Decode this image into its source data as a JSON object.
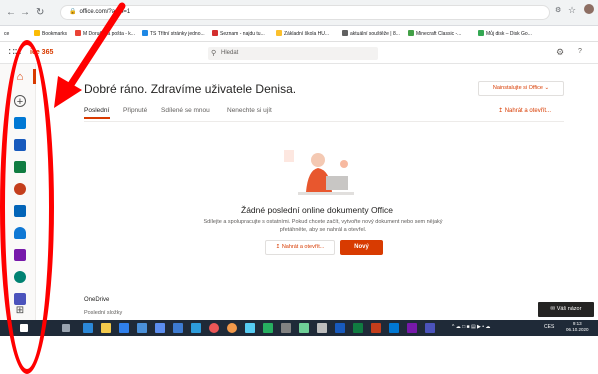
{
  "browser": {
    "url": "office.com/?auth=1",
    "bookmarks": [
      {
        "label": "ce",
        "color": "#ffffff"
      },
      {
        "label": "Bookmarks",
        "color": "#fbbc05"
      },
      {
        "label": "M Doručená pošta - k...",
        "color": "#ea4335"
      },
      {
        "label": "TS Třítní stránky jedno...",
        "color": "#1e88e5"
      },
      {
        "label": "Seznam - najdu tu...",
        "color": "#d32f2f"
      },
      {
        "label": "Základní škola HU...",
        "color": "#fbc02d"
      },
      {
        "label": "aktuální souštěže | 8...",
        "color": "#616161"
      },
      {
        "label": "Minecraft Classic -...",
        "color": "#43a047"
      },
      {
        "label": "Můj disk – Disk Go...",
        "color": "#34a853"
      }
    ]
  },
  "office": {
    "brand": "ice 365",
    "search_placeholder": "Hledat",
    "brand_color": "#d83b01"
  },
  "main": {
    "greeting": "Dobré ráno. Zdravíme uživatele Denisa.",
    "install_label": "Nainstalujte si Office",
    "tabs": [
      "Poslední",
      "Připnuté",
      "Sdílené se mnou",
      "Nenechte si ujít"
    ],
    "upload_label": "Nahrát a otevřít...",
    "empty_title": "Žádné poslední online dokumenty Office",
    "empty_desc": "Sdílejte a spolupracujte s ostatními. Pokud chcete začít, vytvořte nový dokument nebo sem nějaký přetáhněte, aby se nahrál a otevřel.",
    "btn_upload": "Nahrát a otevřít...",
    "btn_new": "Nový",
    "onedrive": "OneDrive",
    "recent_folders": "Poslední složky",
    "feedback": "Váš názor"
  },
  "rail": [
    {
      "name": "outlook",
      "color": "#0078d4"
    },
    {
      "name": "word",
      "color": "#185abd"
    },
    {
      "name": "excel",
      "color": "#107c41"
    },
    {
      "name": "powerpoint",
      "color": "#c43e1c"
    },
    {
      "name": "onedrive",
      "color": "#0364b8"
    },
    {
      "name": "onedrive-cloud",
      "color": "#0f78d4"
    },
    {
      "name": "onenote",
      "color": "#7719aa"
    },
    {
      "name": "sway",
      "color": "#008272"
    },
    {
      "name": "teams",
      "color": "#4b53bc"
    }
  ],
  "taskbar": {
    "lang": "CES",
    "time": "9:13",
    "date": "06.10.2020"
  },
  "annotation_color": "#ff0000"
}
